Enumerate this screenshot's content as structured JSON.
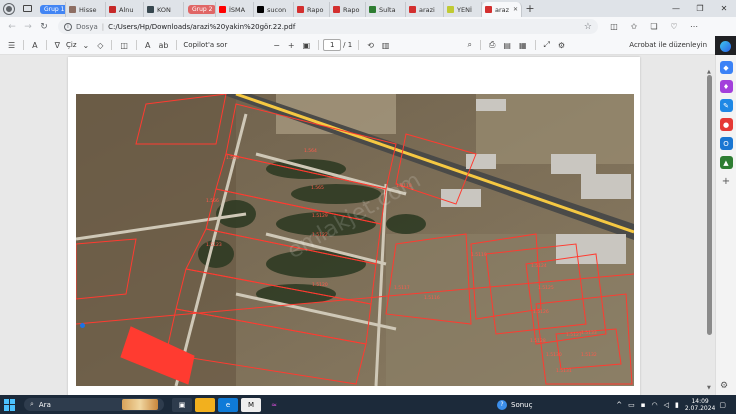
{
  "tabs": [
    {
      "kind": "group",
      "label": "Grup 1",
      "color": "#4285f4"
    },
    {
      "kind": "tab",
      "label": "Hisse",
      "fav": "#8d6e63"
    },
    {
      "kind": "tab",
      "label": "Alnu",
      "fav": "#c62828"
    },
    {
      "kind": "tab",
      "label": "KON",
      "fav": "#37474f"
    },
    {
      "kind": "group",
      "label": "Grup 2",
      "color": "#e06666"
    },
    {
      "kind": "tab",
      "label": "İSMA",
      "fav": "#ff0000"
    },
    {
      "kind": "tab",
      "label": "sucon",
      "fav": "#000000"
    },
    {
      "kind": "tab",
      "label": "Rapo",
      "fav": "#d32f2f"
    },
    {
      "kind": "tab",
      "label": "Rapo",
      "fav": "#d32f2f"
    },
    {
      "kind": "tab",
      "label": "Sulta",
      "fav": "#2e7d32"
    },
    {
      "kind": "tab",
      "label": "arazi",
      "fav": "#d32f2f"
    },
    {
      "kind": "tab",
      "label": "YENİ",
      "fav": "#c0ca33"
    },
    {
      "kind": "active",
      "label": "araz",
      "fav": "#d32f2f"
    }
  ],
  "address": {
    "site_label": "Dosya",
    "url": "C:/Users/Hp/Downloads/arazi%20yakin%20gör.22.pdf"
  },
  "pdf_toolbar": {
    "draw_label": "Çiz",
    "copilot_label": "Copilot'a sor",
    "page_current": "1",
    "page_total": "/ 1",
    "acrobat_label": "Acrobat ile düzenleyin"
  },
  "map": {
    "watermark": "emlakjet.com",
    "parcel_labels": [
      "1.563",
      "1.564",
      "1.565",
      "1.566",
      "1.5129",
      "1.5123",
      "1.5122",
      "1.5120",
      "1.5118",
      "1.5119",
      "1.5117",
      "1.5116",
      "1.5124",
      "1.5125",
      "1.5126",
      "1.5127",
      "1.5128",
      "1.5130",
      "1.5131",
      "1.5132",
      "1.5133"
    ]
  },
  "taskbar": {
    "search_label": "Ara",
    "weather_label": "Sonuç",
    "time": "14:09",
    "date": "2.07.2024"
  },
  "colors": {
    "parcel_outline": "#ff3b30",
    "highlight_parcel": "#ff3b30",
    "road": "#f5c842"
  }
}
